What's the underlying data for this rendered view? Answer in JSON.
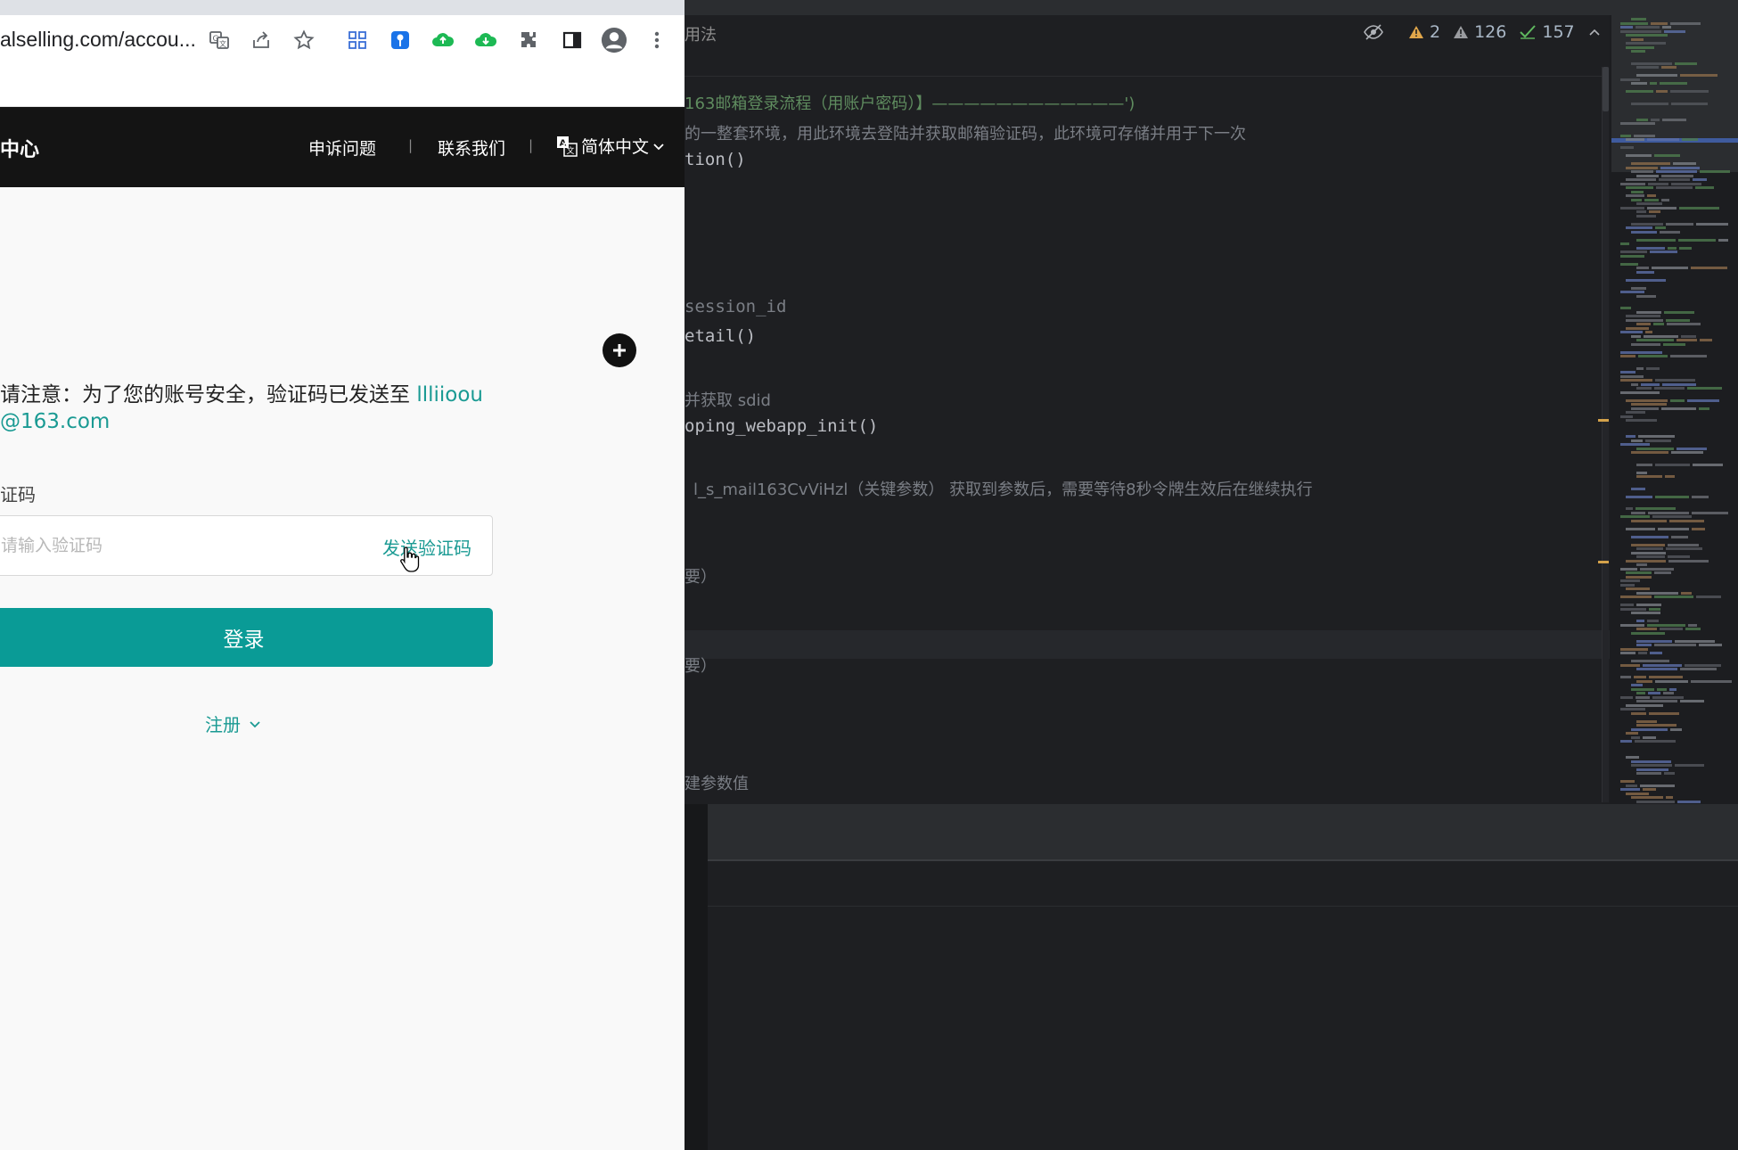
{
  "browser": {
    "url": "alselling.com/accou...",
    "toolbar_icons": [
      "translate-icon",
      "share-icon",
      "star-icon",
      "apps-icon",
      "password-icon",
      "upload-icon",
      "download-icon",
      "extensions-icon",
      "sidepanel-icon",
      "profile-icon",
      "menu-icon"
    ],
    "site": {
      "logo_text": "中心",
      "nav": {
        "complaint": "申诉问题",
        "separator": "|",
        "contact": "联系我们",
        "language": "简体中文"
      },
      "form": {
        "notice_prefix": "请注意：为了您的账号安全，验证码已发送至 ",
        "notice_email_line1": "llliioou",
        "notice_email_line2": "@163.com",
        "code_label": "证码",
        "code_placeholder": "请输入验证码",
        "code_value": "",
        "send_code": "发送验证码",
        "login_button": "登录",
        "register_link": "注册"
      }
    },
    "colors": {
      "accent": "#0a9b96",
      "link": "#1a9a93",
      "header_bg": "#141414"
    }
  },
  "ide": {
    "breadcrumb": "用法",
    "inspections": {
      "warnings": "2",
      "weak_warnings": "126",
      "checks": "157"
    },
    "code_lines": [
      {
        "text": "163邮箱登录流程（用账户密码）】————————————')"
      },
      {
        "text": "的一整套环境，用此环境去登陆并获取邮箱验证码，此环境可存储并用于下一次"
      },
      {
        "text": "tion()"
      },
      {
        "text": "session_id"
      },
      {
        "text": "etail()"
      },
      {
        "text": "并获取 sdid"
      },
      {
        "text": "oping_webapp_init()"
      },
      {
        "text": "l_s_mail163CvViHzl（关键参数） 获取到参数后，需要等待8秒令牌生效后在继续执行"
      },
      {
        "text": "要）"
      },
      {
        "text": "要）"
      },
      {
        "text": "建参数值"
      }
    ]
  }
}
